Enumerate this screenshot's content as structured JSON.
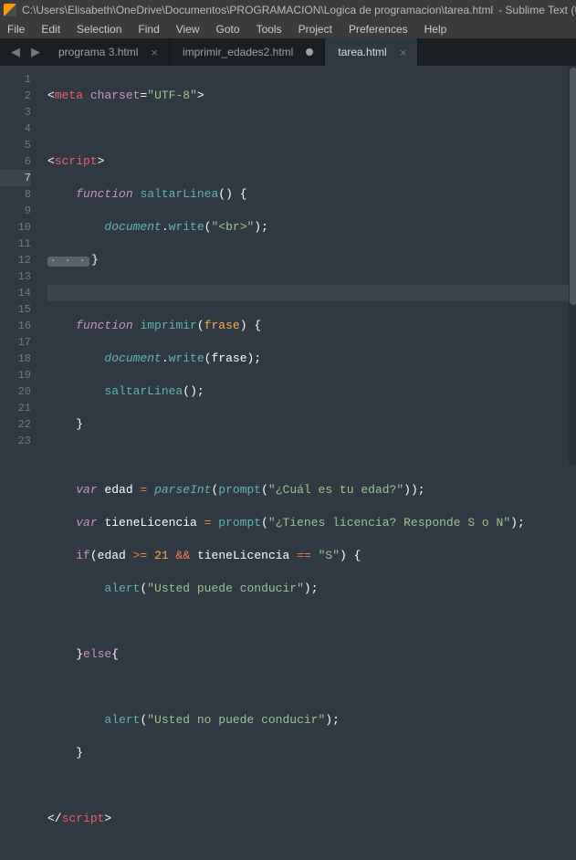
{
  "titlebar": {
    "path": "C:\\Users\\Elisabeth\\OneDrive\\Documentos\\PROGRAMACION\\Logica de programacion\\tarea.html",
    "suffix": " - Sublime Text (U"
  },
  "menu": {
    "file": "File",
    "edit": "Edit",
    "selection": "Selection",
    "find": "Find",
    "view": "View",
    "goto": "Goto",
    "tools": "Tools",
    "project": "Project",
    "preferences": "Preferences",
    "help": "Help"
  },
  "nav": {
    "back": "◀",
    "forward": "▶"
  },
  "tabs": [
    {
      "label": "programa 3.html",
      "dirty": false,
      "active": false
    },
    {
      "label": "imprimir_edades2.html",
      "dirty": true,
      "active": false
    },
    {
      "label": "tarea.html",
      "dirty": false,
      "active": true
    }
  ],
  "lineNumbers": [
    "1",
    "2",
    "3",
    "4",
    "5",
    "6",
    "7",
    "8",
    "9",
    "10",
    "11",
    "12",
    "13",
    "14",
    "15",
    "16",
    "17",
    "18",
    "19",
    "20",
    "21",
    "22",
    "23"
  ],
  "highlightLine": 7,
  "tokens": {
    "lt": "<",
    "gt": ">",
    "close": "</",
    "meta": "meta",
    "charset": "charset",
    "eq": "=",
    "utf8": "\"UTF-8\"",
    "script": "script",
    "function": "function",
    "saltarLinea": "saltarLinea",
    "lpar": "(",
    "rpar": ")",
    "lbr": "{",
    "rbr": "}",
    "document": "document",
    "dot": ".",
    "write": "write",
    "brstr": "\"<br>\"",
    "semi": ";",
    "fold": "· · ·",
    "imprimir": "imprimir",
    "frase": "frase",
    "var": "var",
    "edad": "edad",
    "assign": " = ",
    "parseInt": "parseInt",
    "prompt": "prompt",
    "q_edad": "\"¿Cuál es tu edad?\"",
    "tieneLicencia": "tieneLicencia",
    "q_lic": "\"¿Tienes licencia? Responde S o N\"",
    "if": "if",
    "ge": ">=",
    "n21": "21",
    "andand": "&&",
    "eqeq": "==",
    "S": "\"S\"",
    "alert": "alert",
    "puede": "\"Usted puede conducir\"",
    "else": "else",
    "nopuede": "\"Usted no puede conducir\"",
    "closex": "×"
  }
}
